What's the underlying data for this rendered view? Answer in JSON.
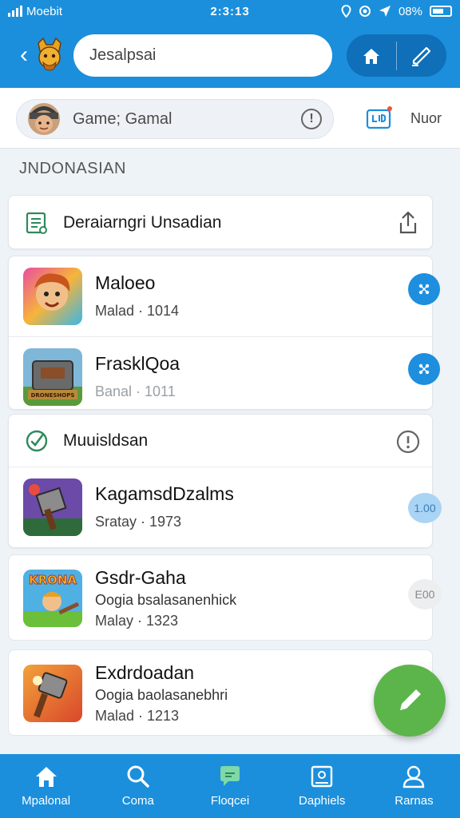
{
  "status_bar": {
    "carrier": "Moebit",
    "time": "2:3:13",
    "battery": "08%"
  },
  "header": {
    "back_icon": "chevron-left-icon",
    "search_value": "Jesalpsai",
    "actions": [
      "home-icon",
      "pen-icon"
    ]
  },
  "filter_bar": {
    "chip_text": "Game; Gamal",
    "scan_icon": "scan-icon",
    "more_label": "Nuor"
  },
  "section_label": "JNDONASIAN",
  "featured_card": {
    "title": "Deraiarngri Unsadian",
    "items": [
      {
        "name": "Maloeo",
        "meta": "Malad · 1014"
      },
      {
        "name": "FrasklQoa",
        "meta": "Banal · 1011"
      }
    ]
  },
  "popular_card": {
    "title": "Muuisldsan",
    "items": [
      {
        "name": "Kagamsdǲalms",
        "meta": "Sratay · 1973",
        "badge": "1.00"
      }
    ]
  },
  "list_items": [
    {
      "name": "Gsdr-Gaha",
      "desc": "Oogia bsalasanenhick",
      "meta": "Malay · 1323",
      "badge": "E00"
    },
    {
      "name": "Exdrdoadan",
      "desc": "Oogia baolasanebhri",
      "meta": "Malad · 1213"
    }
  ],
  "bottom_nav": [
    {
      "label": "Mpalonal",
      "icon": "home-icon"
    },
    {
      "label": "Coma",
      "icon": "search-icon"
    },
    {
      "label": "Floqcei",
      "icon": "chat-icon"
    },
    {
      "label": "Daphiels",
      "icon": "image-icon"
    },
    {
      "label": "Rarnas",
      "icon": "profile-icon"
    }
  ],
  "colors": {
    "primary": "#1b8fdc",
    "primary_dark": "#0f6fb8",
    "fab": "#5cb54a",
    "background": "#eef3f7"
  }
}
